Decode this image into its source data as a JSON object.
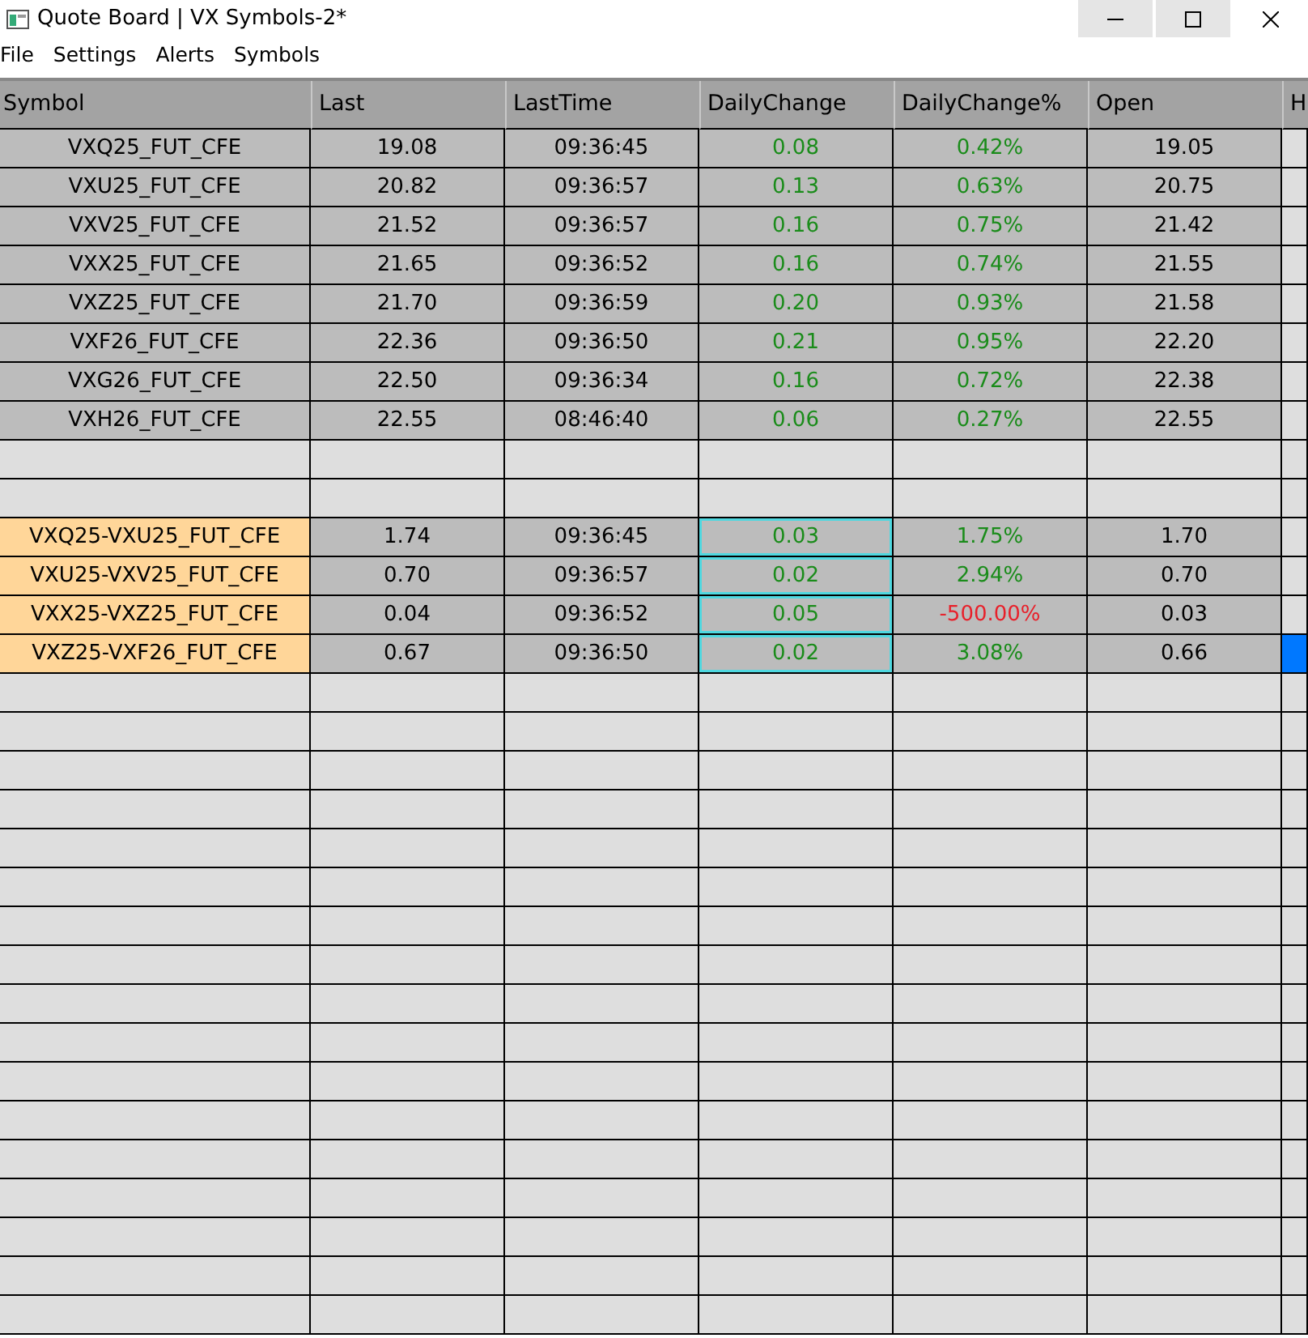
{
  "window": {
    "title": "Quote Board | VX Symbols-2*"
  },
  "menu": [
    "File",
    "Settings",
    "Alerts",
    "Symbols"
  ],
  "columns": [
    "Symbol",
    "Last",
    "LastTime",
    "DailyChange",
    "DailyChange%",
    "Open",
    "H"
  ],
  "rows": [
    {
      "kind": "quote",
      "symbol": "VXQ25_FUT_CFE",
      "last": "19.08",
      "time": "09:36:45",
      "change": "0.08",
      "change_pct": "0.42%",
      "negative": false,
      "open": "19.05",
      "flagged": false,
      "selected": false
    },
    {
      "kind": "quote",
      "symbol": "VXU25_FUT_CFE",
      "last": "20.82",
      "time": "09:36:57",
      "change": "0.13",
      "change_pct": "0.63%",
      "negative": false,
      "open": "20.75",
      "flagged": false,
      "selected": false
    },
    {
      "kind": "quote",
      "symbol": "VXV25_FUT_CFE",
      "last": "21.52",
      "time": "09:36:57",
      "change": "0.16",
      "change_pct": "0.75%",
      "negative": false,
      "open": "21.42",
      "flagged": false,
      "selected": false
    },
    {
      "kind": "quote",
      "symbol": "VXX25_FUT_CFE",
      "last": "21.65",
      "time": "09:36:52",
      "change": "0.16",
      "change_pct": "0.74%",
      "negative": false,
      "open": "21.55",
      "flagged": false,
      "selected": false
    },
    {
      "kind": "quote",
      "symbol": "VXZ25_FUT_CFE",
      "last": "21.70",
      "time": "09:36:59",
      "change": "0.20",
      "change_pct": "0.93%",
      "negative": false,
      "open": "21.58",
      "flagged": false,
      "selected": false
    },
    {
      "kind": "quote",
      "symbol": "VXF26_FUT_CFE",
      "last": "22.36",
      "time": "09:36:50",
      "change": "0.21",
      "change_pct": "0.95%",
      "negative": false,
      "open": "22.20",
      "flagged": false,
      "selected": false
    },
    {
      "kind": "quote",
      "symbol": "VXG26_FUT_CFE",
      "last": "22.50",
      "time": "09:36:34",
      "change": "0.16",
      "change_pct": "0.72%",
      "negative": false,
      "open": "22.38",
      "flagged": false,
      "selected": false
    },
    {
      "kind": "quote",
      "symbol": "VXH26_FUT_CFE",
      "last": "22.55",
      "time": "08:46:40",
      "change": "0.06",
      "change_pct": "0.27%",
      "negative": false,
      "open": "22.55",
      "flagged": false,
      "selected": false
    },
    {
      "kind": "blank"
    },
    {
      "kind": "blank"
    },
    {
      "kind": "spread",
      "symbol": "VXQ25-VXU25_FUT_CFE",
      "last": "1.74",
      "time": "09:36:45",
      "change": "0.03",
      "change_pct": "1.75%",
      "negative": false,
      "open": "1.70",
      "flagged": true,
      "selected": false
    },
    {
      "kind": "spread",
      "symbol": "VXU25-VXV25_FUT_CFE",
      "last": "0.70",
      "time": "09:36:57",
      "change": "0.02",
      "change_pct": "2.94%",
      "negative": false,
      "open": "0.70",
      "flagged": true,
      "selected": false
    },
    {
      "kind": "spread",
      "symbol": "VXX25-VXZ25_FUT_CFE",
      "last": "0.04",
      "time": "09:36:52",
      "change": "0.05",
      "change_pct": "-500.00%",
      "negative": true,
      "open": "0.03",
      "flagged": true,
      "selected": false
    },
    {
      "kind": "spread",
      "symbol": "VXZ25-VXF26_FUT_CFE",
      "last": "0.67",
      "time": "09:36:50",
      "change": "0.02",
      "change_pct": "3.08%",
      "negative": false,
      "open": "0.66",
      "flagged": true,
      "selected": true
    }
  ]
}
